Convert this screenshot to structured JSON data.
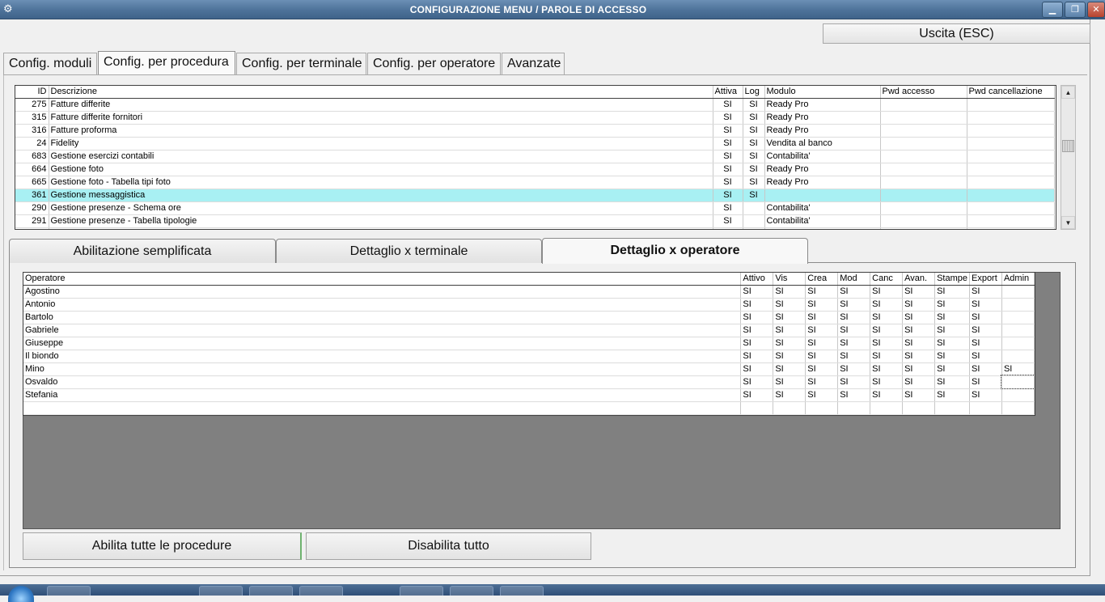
{
  "window": {
    "title": "CONFIGURAZIONE MENU / PAROLE DI ACCESSO",
    "app_icon": "app-icon",
    "minimize": "▁",
    "maximize": "❐",
    "close": "✕"
  },
  "toolbar": {
    "exit_label": "Uscita (ESC)"
  },
  "tabs": [
    {
      "label": "Config. moduli"
    },
    {
      "label": "Config. per procedura"
    },
    {
      "label": "Config. per terminale"
    },
    {
      "label": "Config. per operatore"
    },
    {
      "label": "Avanzate"
    }
  ],
  "active_tab": "Config. per procedura",
  "procedures": {
    "columns": [
      "ID",
      "Descrizione",
      "Attiva",
      "Log",
      "Modulo",
      "Pwd accesso",
      "Pwd cancellazione"
    ],
    "rows": [
      {
        "id": "275",
        "desc": "Fatture differite",
        "attiva": "SI",
        "log": "SI",
        "modulo": "Ready Pro",
        "pwd": "",
        "pwdc": ""
      },
      {
        "id": "315",
        "desc": "Fatture differite fornitori",
        "attiva": "SI",
        "log": "SI",
        "modulo": "Ready Pro",
        "pwd": "",
        "pwdc": ""
      },
      {
        "id": "316",
        "desc": "Fatture proforma",
        "attiva": "SI",
        "log": "SI",
        "modulo": "Ready Pro",
        "pwd": "",
        "pwdc": ""
      },
      {
        "id": "24",
        "desc": "Fidelity",
        "attiva": "SI",
        "log": "SI",
        "modulo": "Vendita al banco",
        "pwd": "",
        "pwdc": ""
      },
      {
        "id": "683",
        "desc": "Gestione esercizi contabili",
        "attiva": "SI",
        "log": "SI",
        "modulo": "Contabilita'",
        "pwd": "",
        "pwdc": ""
      },
      {
        "id": "664",
        "desc": "Gestione foto",
        "attiva": "SI",
        "log": "SI",
        "modulo": "Ready Pro",
        "pwd": "",
        "pwdc": ""
      },
      {
        "id": "665",
        "desc": "Gestione foto - Tabella tipi foto",
        "attiva": "SI",
        "log": "SI",
        "modulo": "Ready Pro",
        "pwd": "",
        "pwdc": ""
      },
      {
        "id": "361",
        "desc": "Gestione messaggistica",
        "attiva": "SI",
        "log": "SI",
        "modulo": "",
        "pwd": "",
        "pwdc": ""
      },
      {
        "id": "290",
        "desc": "Gestione presenze - Schema ore",
        "attiva": "SI",
        "log": "",
        "modulo": "Contabilita'",
        "pwd": "",
        "pwdc": ""
      },
      {
        "id": "291",
        "desc": "Gestione presenze - Tabella tipologie",
        "attiva": "SI",
        "log": "",
        "modulo": "Contabilita'",
        "pwd": "",
        "pwdc": ""
      }
    ],
    "selected_index": 7,
    "scroll_up": "▲",
    "scroll_down": "▼"
  },
  "subtabs": [
    {
      "label": "Abilitazione semplificata"
    },
    {
      "label": "Dettaglio x terminale"
    },
    {
      "label": "Dettaglio x operatore"
    }
  ],
  "active_subtab": "Dettaglio x operatore",
  "operators": {
    "columns": [
      "Operatore",
      "Attivo",
      "Vis",
      "Crea",
      "Mod",
      "Canc",
      "Avan.",
      "Stampe",
      "Export",
      "Admin"
    ],
    "rows": [
      {
        "name": "Agostino",
        "vals": [
          "SI",
          "SI",
          "SI",
          "SI",
          "SI",
          "SI",
          "SI",
          "SI",
          ""
        ]
      },
      {
        "name": "Antonio",
        "vals": [
          "SI",
          "SI",
          "SI",
          "SI",
          "SI",
          "SI",
          "SI",
          "SI",
          ""
        ]
      },
      {
        "name": "Bartolo",
        "vals": [
          "SI",
          "SI",
          "SI",
          "SI",
          "SI",
          "SI",
          "SI",
          "SI",
          ""
        ]
      },
      {
        "name": "Gabriele",
        "vals": [
          "SI",
          "SI",
          "SI",
          "SI",
          "SI",
          "SI",
          "SI",
          "SI",
          ""
        ]
      },
      {
        "name": "Giuseppe",
        "vals": [
          "SI",
          "SI",
          "SI",
          "SI",
          "SI",
          "SI",
          "SI",
          "SI",
          ""
        ]
      },
      {
        "name": "Il biondo",
        "vals": [
          "SI",
          "SI",
          "SI",
          "SI",
          "SI",
          "SI",
          "SI",
          "SI",
          ""
        ]
      },
      {
        "name": "Mino",
        "vals": [
          "SI",
          "SI",
          "SI",
          "SI",
          "SI",
          "SI",
          "SI",
          "SI",
          "SI"
        ]
      },
      {
        "name": "Osvaldo",
        "vals": [
          "SI",
          "SI",
          "SI",
          "SI",
          "SI",
          "SI",
          "SI",
          "SI",
          ""
        ]
      },
      {
        "name": "Stefania",
        "vals": [
          "SI",
          "SI",
          "SI",
          "SI",
          "SI",
          "SI",
          "SI",
          "SI",
          ""
        ]
      }
    ]
  },
  "actions": {
    "enable_all": "Abilita tutte le procedure",
    "disable_all": "Disabilita tutto"
  }
}
